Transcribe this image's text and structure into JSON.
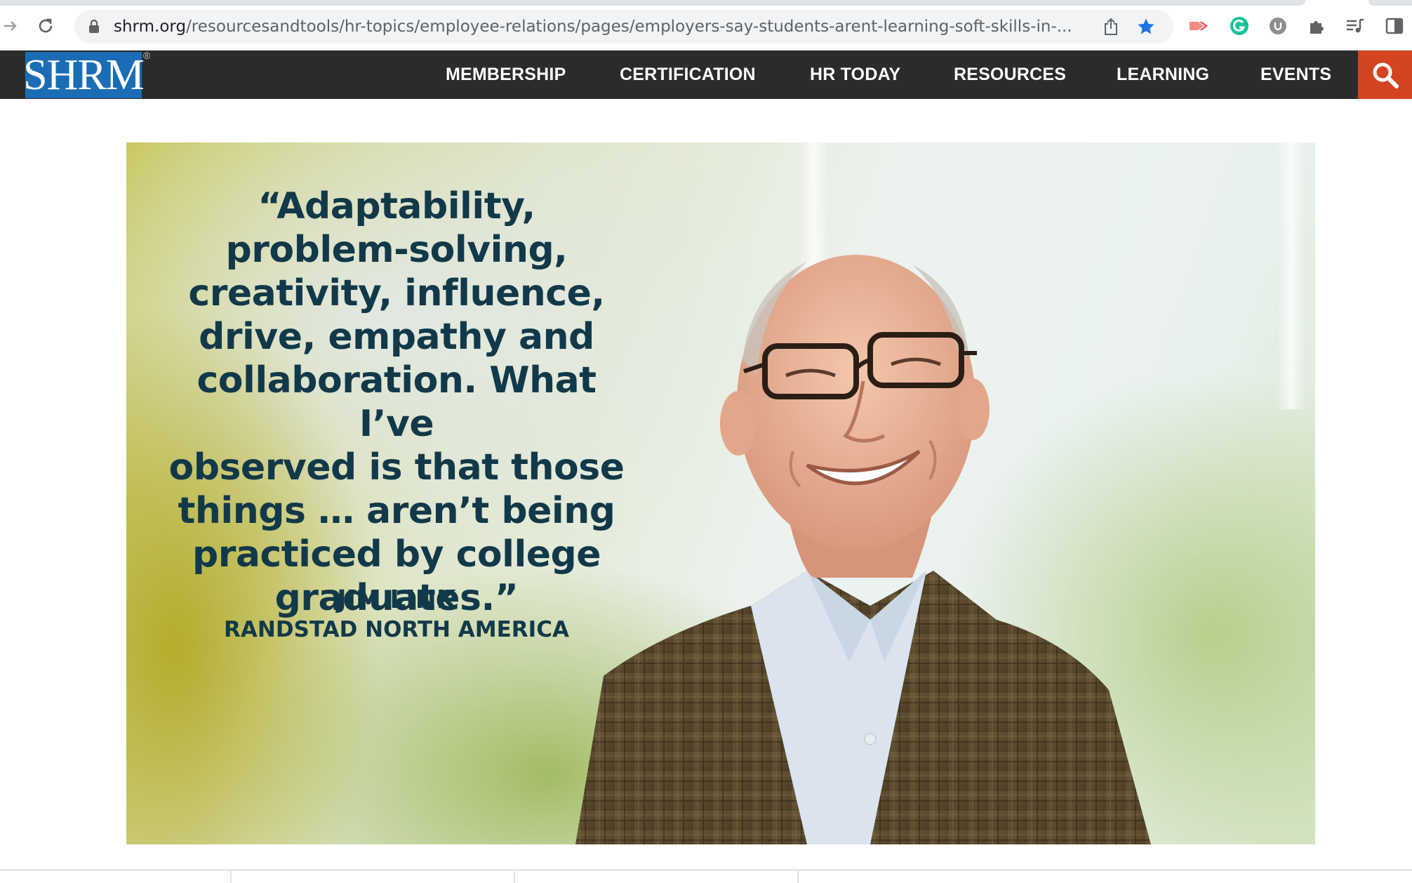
{
  "browser": {
    "url_host": "shrm.org",
    "url_path": "/resourcesandtools/hr-topics/employee-relations/pages/employers-say-students-arent-learning-soft-skills-in-...",
    "icons": [
      "forward-icon",
      "reload-icon",
      "lock-icon",
      "share-icon",
      "bookmark-star-icon",
      "extension-arrow-icon",
      "grammarly-icon",
      "extension-u-icon",
      "puzzle-extensions-icon",
      "media-queue-icon",
      "side-panel-icon"
    ],
    "accent_color": "#1a73e8"
  },
  "site": {
    "logo_text": "SHRM",
    "logo_reg": "®",
    "nav": [
      "MEMBERSHIP",
      "CERTIFICATION",
      "HR TODAY",
      "RESOURCES",
      "LEARNING",
      "EVENTS"
    ],
    "header_color": "#2b2b2b",
    "logo_color": "#1a6db5",
    "search_color": "#d4441f"
  },
  "hero": {
    "quote": "“Adaptability,\nproblem-solving,\ncreativity, influence,\ndrive, empathy and\ncollaboration. What I’ve\nobserved is that those\nthings … aren’t being\npracticed by college\ngraduates.”",
    "attribution_name": "JIM LINK",
    "attribution_org": "RANDSTAD NORTH AMERICA",
    "text_color": "#12394a"
  }
}
